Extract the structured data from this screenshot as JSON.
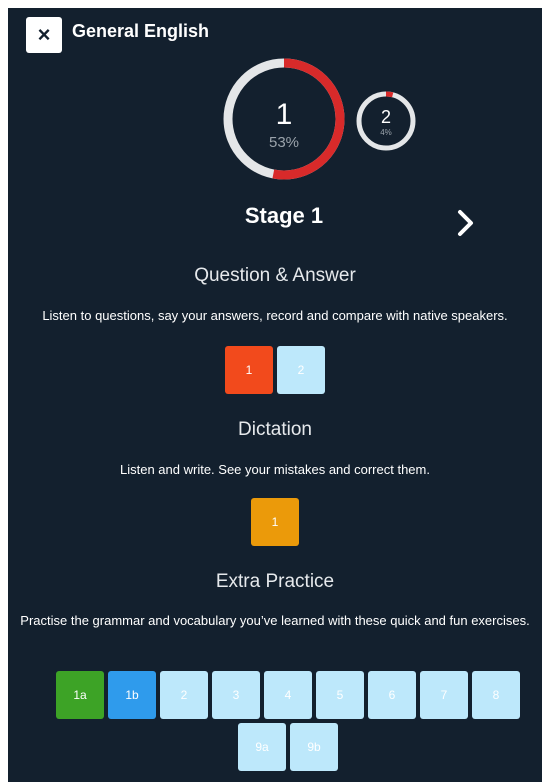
{
  "header": {
    "close_glyph": "×",
    "title": "General English"
  },
  "progress": {
    "current": {
      "label": "1",
      "percent_text": "53%",
      "fraction": 0.53
    },
    "next": {
      "label": "2",
      "percent_text": "4%",
      "fraction": 0.04
    },
    "colors": {
      "track": "#e4e6e8",
      "fill": "#d82a2a"
    }
  },
  "stage": {
    "title": "Stage 1",
    "next_icon": "chevron-right-icon"
  },
  "sections": {
    "qa": {
      "title": "Question & Answer",
      "description": "Listen to questions, say your answers, record and compare with native speakers.",
      "tiles": [
        {
          "label": "1",
          "color": "#f24a1c"
        },
        {
          "label": "2",
          "color": "#bde8fb"
        }
      ]
    },
    "dictation": {
      "title": "Dictation",
      "description": "Listen and write. See your mistakes and correct them.",
      "tiles": [
        {
          "label": "1",
          "color": "#eb9a0a"
        }
      ]
    },
    "extra": {
      "title": "Extra Practice",
      "description": "Practise the grammar and vocabulary you’ve learned with these quick and fun exercises.",
      "tiles": [
        {
          "label": "1a",
          "color": "#3da326"
        },
        {
          "label": "1b",
          "color": "#2f9bec"
        },
        {
          "label": "2",
          "color": "#bde8fb"
        },
        {
          "label": "3",
          "color": "#bde8fb"
        },
        {
          "label": "4",
          "color": "#bde8fb"
        },
        {
          "label": "5",
          "color": "#bde8fb"
        },
        {
          "label": "6",
          "color": "#bde8fb"
        },
        {
          "label": "7",
          "color": "#bde8fb"
        },
        {
          "label": "8",
          "color": "#bde8fb"
        },
        {
          "label": "9a",
          "color": "#bde8fb"
        },
        {
          "label": "9b",
          "color": "#bde8fb"
        }
      ]
    }
  }
}
